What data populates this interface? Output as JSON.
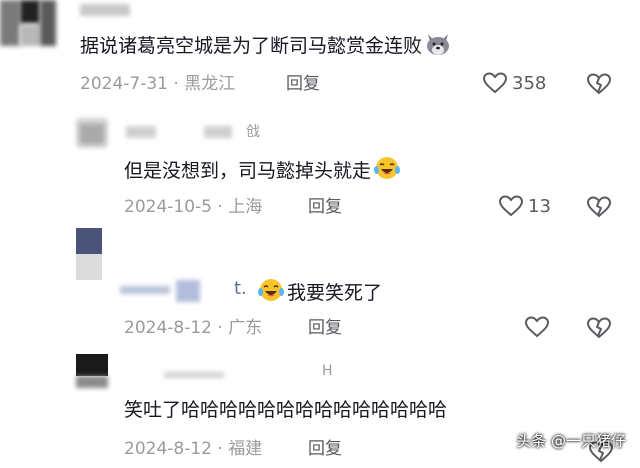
{
  "comments": [
    {
      "text": "据说诸葛亮空城是为了断司马懿赏金连败",
      "date": "2024-7-31",
      "location": "黑龙江",
      "reply_label": "回复",
      "likes": "358"
    },
    {
      "username_partial": "戗",
      "text": "但是没想到，司马懿掉头就走",
      "date": "2024-10-5",
      "location": "上海",
      "reply_label": "回复",
      "likes": "13"
    },
    {
      "username_partial": "t.",
      "text": "我要笑死了",
      "date": "2024-8-12",
      "location": "广东",
      "reply_label": "回复",
      "likes": ""
    },
    {
      "username_partial": "H",
      "text": "笑吐了哈哈哈哈哈哈哈哈哈哈哈哈哈哈",
      "date": "2024-8-12",
      "location": "福建",
      "reply_label": "回复",
      "likes": ""
    }
  ],
  "separator": "·",
  "watermark": "头条 @一只猪仔",
  "icons": {
    "like": "heart-outline-icon",
    "dislike": "broken-heart-icon",
    "emoji_wolf": "wolf-emoji-icon",
    "emoji_laugh": "laughing-tears-emoji-icon"
  }
}
